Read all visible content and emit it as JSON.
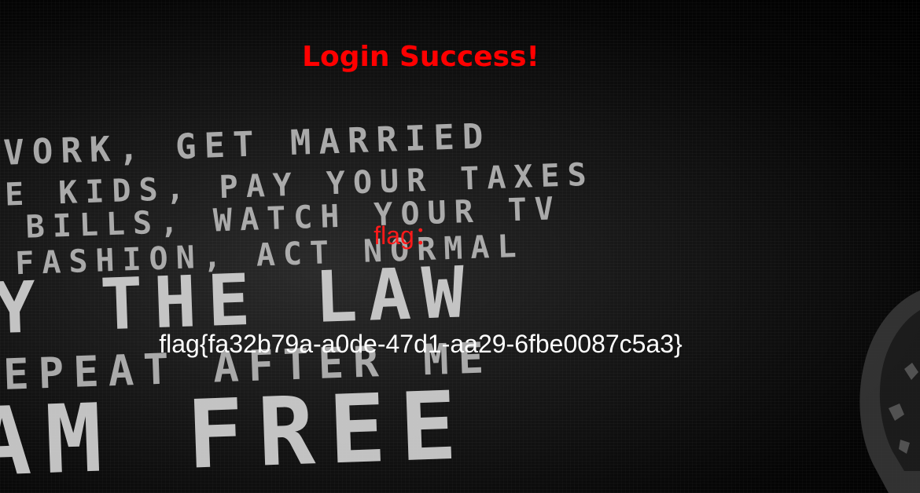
{
  "page": {
    "title": "Login Success!",
    "flag_label": "flag：",
    "flag_value": "flag{fa32b79a-a0de-47d1-aa29-6fbe0087c5a3}"
  },
  "colors": {
    "title": "#ff0000",
    "flag_label": "#ff1a1a",
    "flag_value": "#ffffff",
    "background": "#000000"
  }
}
